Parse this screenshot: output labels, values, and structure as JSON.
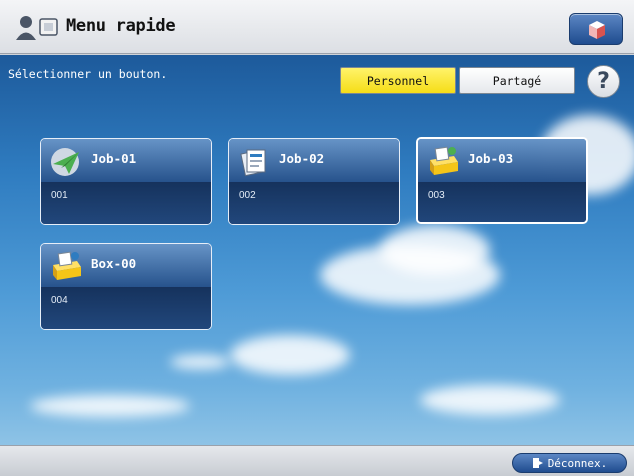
{
  "header": {
    "title": "Menu rapide",
    "home_icon": "home-user-icon",
    "top_button_icon": "cube-icon"
  },
  "main": {
    "instruction": "Sélectionner un bouton.",
    "segments": [
      {
        "label": "Personnel",
        "active": true
      },
      {
        "label": "Partagé",
        "active": false
      }
    ],
    "help_label": "?",
    "tiles": [
      {
        "name": "Job-01",
        "number": "001",
        "icon": "paper-plane-icon"
      },
      {
        "name": "Job-02",
        "number": "002",
        "icon": "document-stack-icon"
      },
      {
        "name": "Job-03",
        "number": "003",
        "icon": "folder-box-icon",
        "selected": true
      },
      {
        "name": "Box-00",
        "number": "004",
        "icon": "folder-box-icon"
      }
    ]
  },
  "footer": {
    "logout_label": "Déconnex.",
    "logout_icon": "logout-door-icon"
  },
  "colors": {
    "accent_active": "#f5dd17",
    "tile_bg": "#1c4276",
    "button_blue": "#1f4c8f"
  }
}
